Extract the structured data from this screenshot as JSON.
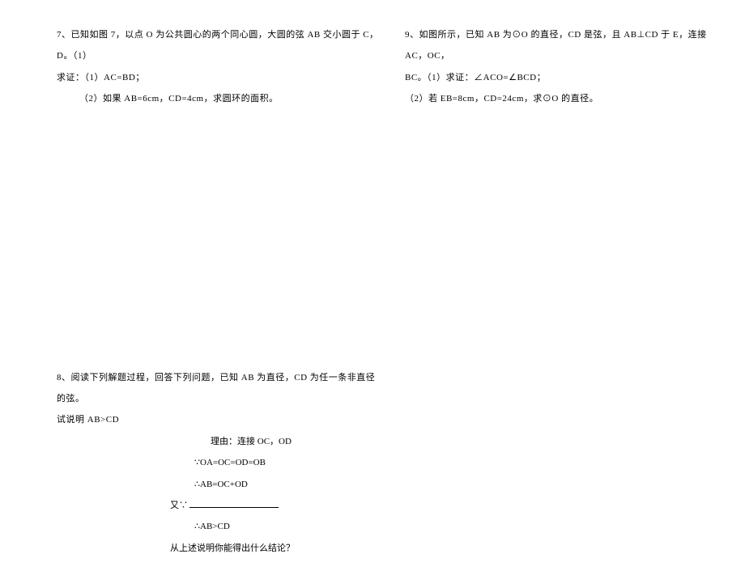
{
  "left": {
    "q7": {
      "line1": "7、已知如图 7，以点 O 为公共圆心的两个同心圆，大圆的弦 AB 交小圆于 C，D。（1）",
      "line2": "求证：（1）AC=BD；",
      "line3": "（2）如果 AB=6cm，CD=4cm，求圆环的面积。"
    },
    "q8": {
      "line1": "8、阅读下列解题过程，回答下列问题，已知 AB 为直径，CD 为任一条非直径的弦。",
      "line2": "试说明 AB>CD",
      "r1": "理由：连接 OC，OD",
      "r2": "∵OA=OC=OD=OB",
      "r3": "∴AB=OC+OD",
      "r4_prefix": "又∵",
      "r5": "∴AB>CD",
      "r6": "从上述说明你能得出什么结论？"
    }
  },
  "right": {
    "q9": {
      "line1": "9、如图所示，已知 AB 为⊙O 的直径，CD 是弦，且 AB⊥CD 于 E，连接 AC，OC，",
      "line2": "BC。（1）求证：∠ACO=∠BCD；",
      "line3": "（2）若 EB=8cm，CD=24cm，求⊙O 的直径。"
    }
  }
}
